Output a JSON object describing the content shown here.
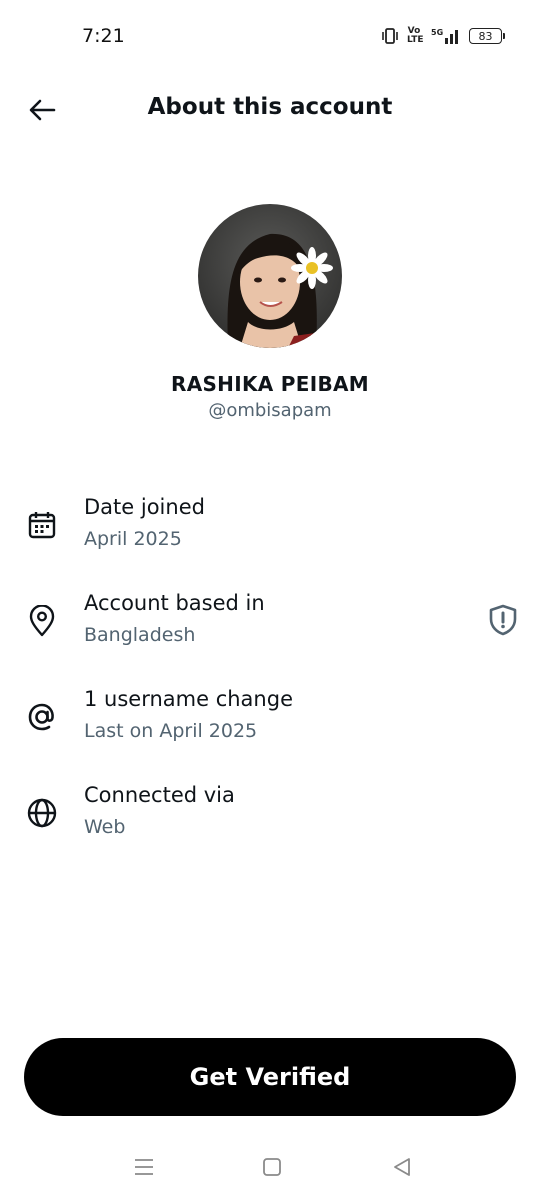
{
  "status_bar": {
    "time": "7:21",
    "network": "5G",
    "volte_line1": "Vo",
    "volte_line2": "LTE",
    "battery": "83"
  },
  "header": {
    "title": "About this account",
    "back_icon": "arrow-left-icon"
  },
  "profile": {
    "display_name": "RASHIKA PEIBAM",
    "handle": "@ombisapam"
  },
  "info": [
    {
      "icon": "calendar-icon",
      "title": "Date joined",
      "subtitle": "April 2025"
    },
    {
      "icon": "location-pin-icon",
      "title": "Account based in",
      "subtitle": "Bangladesh",
      "badge_icon": "shield-alert-icon"
    },
    {
      "icon": "at-sign-icon",
      "title": "1 username change",
      "subtitle": "Last on April 2025"
    },
    {
      "icon": "globe-icon",
      "title": "Connected via",
      "subtitle": "Web"
    }
  ],
  "cta": {
    "label": "Get Verified"
  },
  "nav": {
    "items": [
      "menu-icon",
      "home-square-icon",
      "back-triangle-icon"
    ]
  },
  "colors": {
    "text_primary": "#0f1419",
    "text_secondary": "#536471",
    "button_bg": "#000000",
    "button_text": "#ffffff"
  }
}
